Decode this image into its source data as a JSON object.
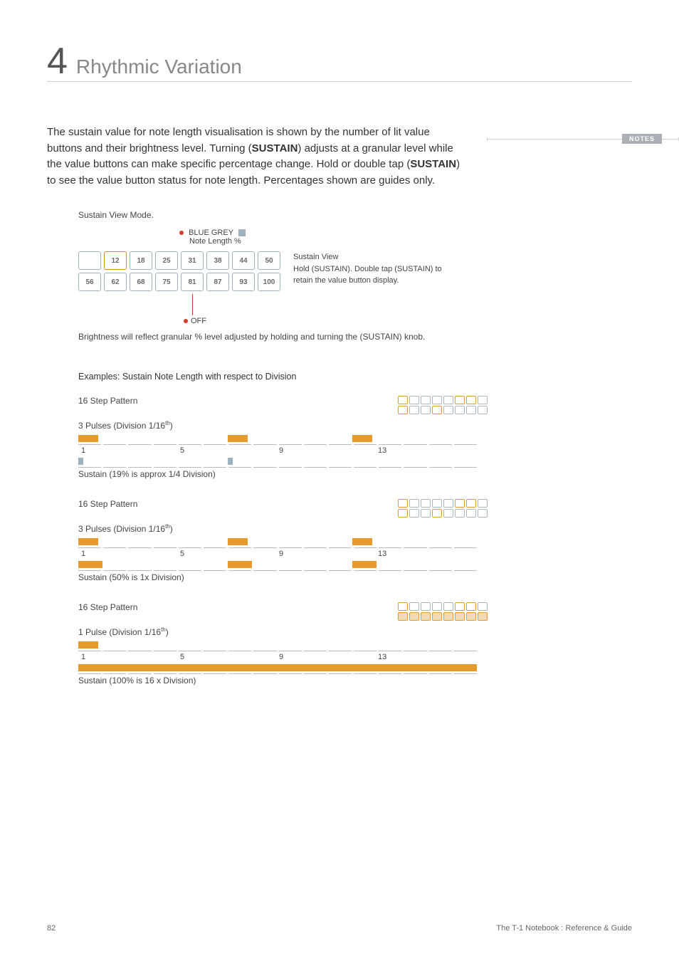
{
  "chapter": {
    "number": "4",
    "title": "Rhythmic Variation"
  },
  "notes_label": "NOTES",
  "body": {
    "p1a": "The sustain value for note length visualisation is shown by the number of lit value buttons and their brightness level. Turning (",
    "p1b": "SUSTAIN",
    "p1c": ") adjusts at a granular level while the value buttons can make specific percentage change. Hold or double tap (",
    "p1d": "SUSTAIN",
    "p1e": ") to see the value button status for note length. Percentages shown are guides only."
  },
  "sustain_mode": {
    "caption": "Sustain View Mode.",
    "label_title": "BLUE GREY",
    "label_sub": "Note Length %",
    "row1": [
      "",
      "12",
      "18",
      "25",
      "31",
      "38",
      "44",
      "50"
    ],
    "row2": [
      "56",
      "62",
      "68",
      "75",
      "81",
      "87",
      "93",
      "100"
    ],
    "side_title": "Sustain View",
    "side_text": "Hold (SUSTAIN). Double tap (SUSTAIN) to retain the value button display.",
    "off_label": "OFF",
    "brightness_note": "Brightness will reflect granular % level adjusted by holding and turning the (SUSTAIN) knob."
  },
  "examples_head": "Examples: Sustain Note Length with respect to Division",
  "tick_labels": [
    "1",
    "5",
    "9",
    "13"
  ],
  "ex1": {
    "title": "16 Step Pattern",
    "minigrid_top_on": [
      0,
      5,
      6
    ],
    "minigrid_bot_on": [
      0,
      3
    ],
    "pulses_label_a": "3 Pulses (Division 1/16",
    "pulses_label_b": "th",
    "pulses_label_c": ")",
    "sustain_caption": "Sustain (19% is approx 1/4 Division)"
  },
  "ex2": {
    "title": "16 Step Pattern",
    "minigrid_top_on": [
      0,
      5,
      6
    ],
    "minigrid_bot_on": [
      0,
      3
    ],
    "pulses_label_a": "3 Pulses (Division 1/16",
    "pulses_label_b": "th",
    "pulses_label_c": ")",
    "sustain_caption": "Sustain (50% is 1x Division)"
  },
  "ex3": {
    "title": "16 Step Pattern",
    "minigrid_top_on": [
      0,
      5,
      6
    ],
    "minigrid_bot_fill": [
      0,
      1,
      2,
      3,
      4,
      5,
      6,
      7
    ],
    "pulses_label_a": "1 Pulse (Division 1/16",
    "pulses_label_b": "th",
    "pulses_label_c": ")",
    "sustain_caption": "Sustain (100% is 16 x Division)"
  },
  "footer": {
    "page": "82",
    "doc": "The T-1 Notebook : Reference & Guide"
  }
}
